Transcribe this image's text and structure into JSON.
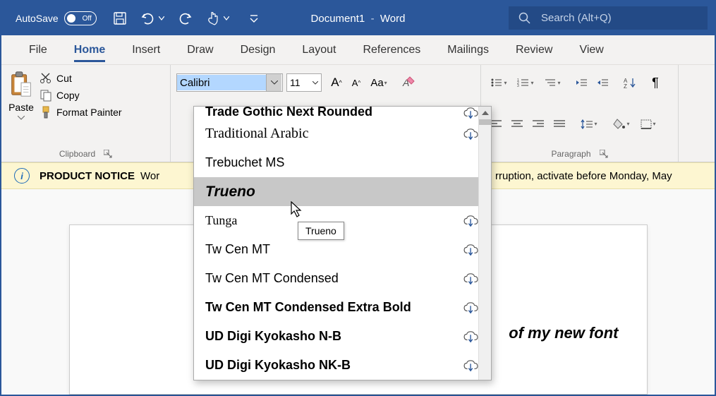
{
  "titlebar": {
    "autosave_label": "AutoSave",
    "autosave_state": "Off",
    "doc_name": "Document1",
    "app_name": "Word",
    "search_placeholder": "Search (Alt+Q)"
  },
  "tabs": [
    "File",
    "Home",
    "Insert",
    "Draw",
    "Design",
    "Layout",
    "References",
    "Mailings",
    "Review",
    "View"
  ],
  "active_tab": "Home",
  "clipboard": {
    "paste_label": "Paste",
    "cut_label": "Cut",
    "copy_label": "Copy",
    "format_painter_label": "Format Painter",
    "group_label": "Clipboard"
  },
  "font": {
    "current_font": "Calibri",
    "current_size": "11"
  },
  "paragraph": {
    "group_label": "Paragraph"
  },
  "notice": {
    "title": "PRODUCT NOTICE",
    "text_left": "Wor",
    "text_right": "rruption, activate before Monday, May"
  },
  "font_dropdown": {
    "items": [
      {
        "name": "Trade Gothic Next Rounded",
        "style": "font-family:Arial;font-weight:600",
        "cloud": true,
        "cutoff": true
      },
      {
        "name": "Traditional Arabic",
        "style": "font-family:'Times New Roman',serif;font-size:20px",
        "cloud": true
      },
      {
        "name": "Trebuchet MS",
        "style": "font-family:'Trebuchet MS',sans-serif",
        "cloud": false
      },
      {
        "name": "Trueno",
        "style": "font-family:Arial;font-weight:900;font-style:italic;font-size:21px",
        "cloud": false,
        "hover": true
      },
      {
        "name": "Tunga",
        "style": "font-family:Tahoma",
        "cloud": true
      },
      {
        "name": "Tw Cen MT",
        "style": "font-family:'Tw Cen MT','Century Gothic',sans-serif",
        "cloud": true
      },
      {
        "name": "Tw Cen MT Condensed",
        "style": "font-family:'Tw Cen MT Condensed','Arial Narrow',sans-serif;font-stretch:condensed",
        "cloud": true
      },
      {
        "name": "Tw Cen MT Condensed Extra Bold",
        "style": "font-family:'Tw Cen MT Condensed Extra Bold','Arial Narrow',sans-serif;font-weight:900",
        "cloud": true
      },
      {
        "name": "UD Digi Kyokasho N-B",
        "style": "font-family:Arial;font-weight:600",
        "cloud": true
      },
      {
        "name": "UD Digi Kyokasho NK-B",
        "style": "font-family:Arial;font-weight:600",
        "cloud": true
      }
    ],
    "tooltip": "Trueno"
  },
  "document": {
    "visible_text": "of my new font"
  }
}
